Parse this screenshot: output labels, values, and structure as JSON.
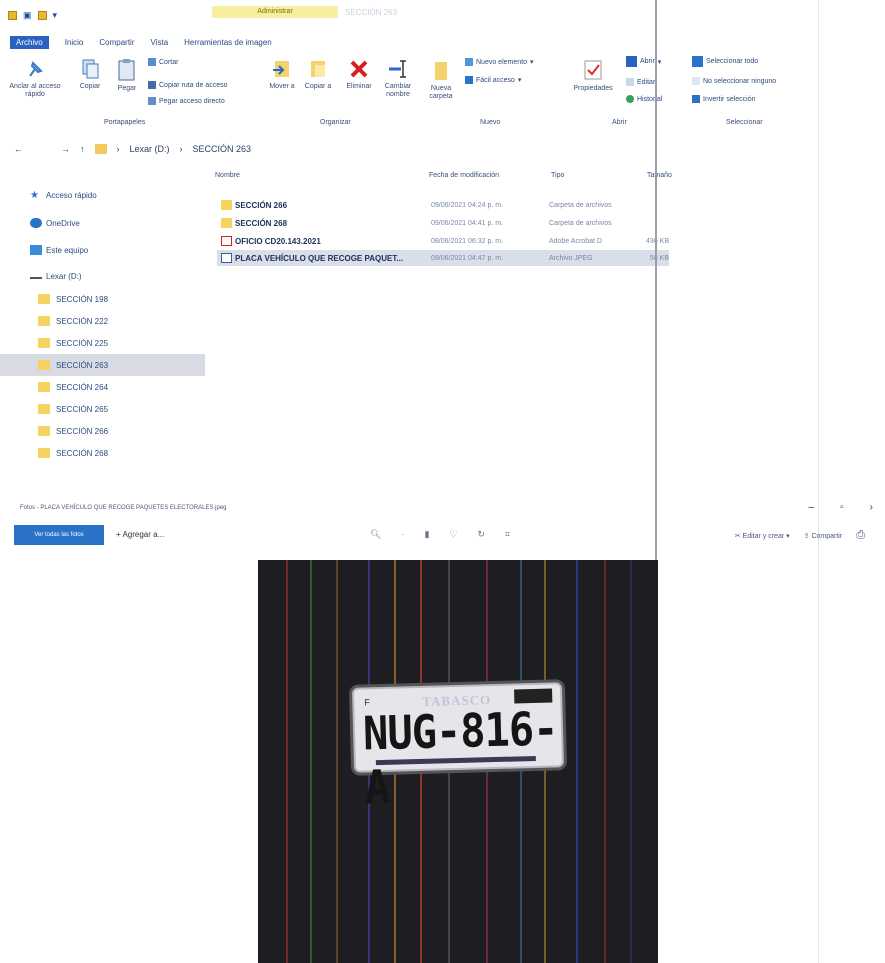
{
  "explorer": {
    "context_tab": "Administrar",
    "window_title": "SECCIÓN 263",
    "ribbon_tabs": [
      "Archivo",
      "Inicio",
      "Compartir",
      "Vista",
      "Herramientas de imagen"
    ],
    "clipboard": {
      "pin": "Anclar al acceso rápido",
      "copy": "Copiar",
      "paste": "Pegar",
      "cut": "Cortar",
      "copy_path": "Copiar ruta de acceso",
      "paste_shortcut": "Pegar acceso directo",
      "group": "Portapapeles"
    },
    "organize": {
      "move": "Mover a",
      "copy_to": "Copiar a",
      "delete": "Eliminar",
      "rename": "Cambiar nombre",
      "group": "Organizar"
    },
    "new": {
      "new_folder": "Nueva carpeta",
      "new_item": "Nuevo elemento",
      "easy_access": "Fácil acceso",
      "group": "Nuevo"
    },
    "open": {
      "properties": "Propiedades",
      "open": "Abrir",
      "edit": "Editar",
      "history": "Historial",
      "group": "Abrir"
    },
    "select": {
      "select_all": "Seleccionar todo",
      "select_none": "No seleccionar ninguno",
      "invert": "Invertir selección",
      "group": "Seleccionar"
    },
    "breadcrumb": [
      "Lexar (D:)",
      "SECCIÓN 263"
    ],
    "nav": {
      "quick_access": "Acceso rápido",
      "onedrive": "OneDrive",
      "this_pc": "Este equipo",
      "drive": "Lexar (D:)",
      "folders": [
        "SECCIÓN 198",
        "SECCIÓN 222",
        "SECCIÓN 225",
        "SECCIÓN 263",
        "SECCIÓN 264",
        "SECCIÓN 265",
        "SECCIÓN 266",
        "SECCIÓN 268"
      ]
    },
    "columns": {
      "name": "Nombre",
      "date": "Fecha de modificación",
      "type": "Tipo",
      "size": "Tamaño"
    },
    "files": [
      {
        "name": "SECCIÓN 266",
        "date": "09/06/2021 04:24 p. m.",
        "type": "Carpeta de archivos",
        "size": ""
      },
      {
        "name": "SECCIÓN 268",
        "date": "09/06/2021 04:41 p. m.",
        "type": "Carpeta de archivos",
        "size": ""
      },
      {
        "name": "OFICIO CD20.143.2021",
        "date": "08/06/2021 06:32 p. m.",
        "type": "Adobe Acrobat D",
        "size": "436 KB"
      },
      {
        "name": "PLACA VEHÍCULO QUE RECOGE PAQUET...",
        "date": "09/06/2021 04:47 p. m.",
        "type": "Archivo JPEG",
        "size": "58 KB"
      }
    ]
  },
  "photos": {
    "title": "Fotos - PLACA VEHÍCULO QUE RECOGE PAQUETES ELECTORALES.jpeg",
    "see_all": "Ver todas las fotos",
    "add_to": "+ Agregar a...",
    "edit_create": "Editar y crear",
    "share": "Compartir",
    "plate": {
      "state": "TABASCO",
      "letter": "F",
      "number": "NUG-816-A"
    }
  }
}
